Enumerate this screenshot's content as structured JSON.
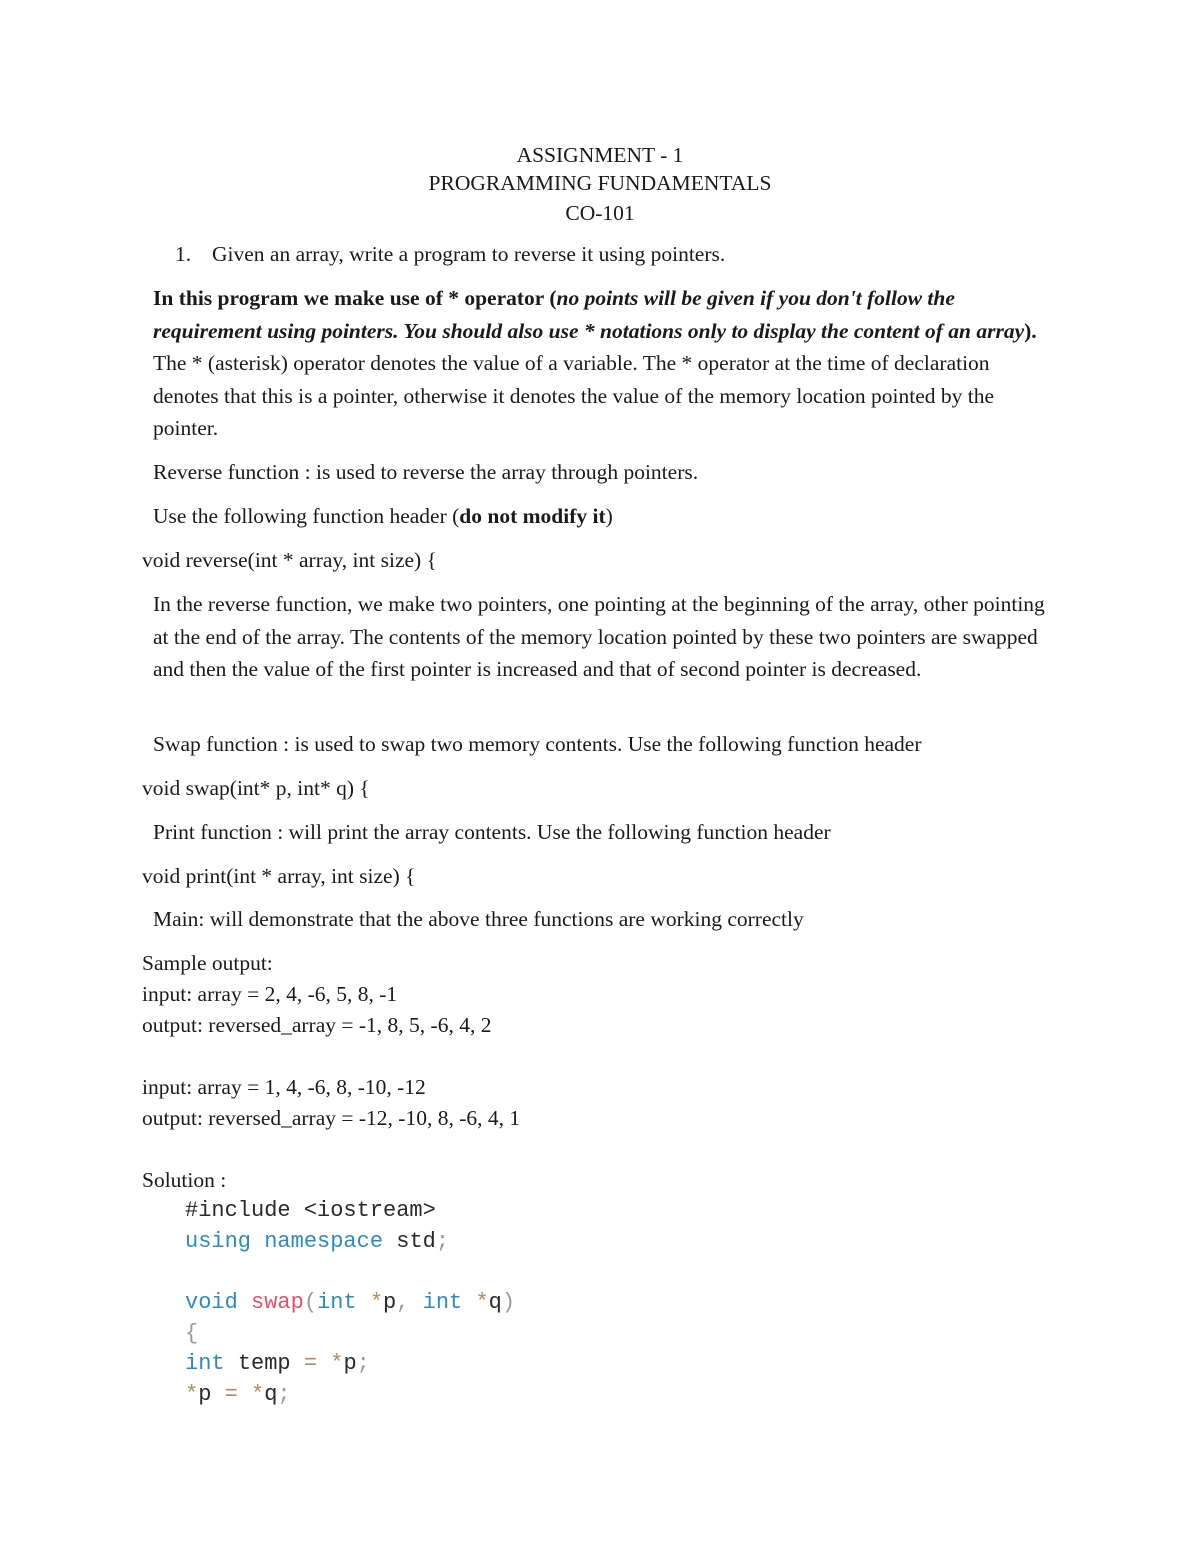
{
  "header": {
    "title": "ASSIGNMENT - 1",
    "subject": "PROGRAMMING FUNDAMENTALS",
    "code": "CO-101"
  },
  "question": {
    "number": "1.",
    "text": "Given an array, write a program to reverse it using pointers."
  },
  "intro": {
    "bold_lead": "In this program we make use of * operator (",
    "bold_italic": "no points will be given if you don't follow the requirement using pointers. You should also use * notations only to display the content of an array",
    "bold_close": ").",
    "rest": " The * (asterisk) operator denotes the value of a variable. The * operator at the time of declaration denotes that this is a pointer, otherwise it denotes the value of the memory location pointed by the pointer."
  },
  "reverse_desc": "Reverse function : is used to reverse the array through pointers.",
  "header_note": {
    "text": "Use the following function header (",
    "bold": "do not modify it",
    "close": ")"
  },
  "reverse_header": "void reverse(int * array, int size) {",
  "reverse_explain": "In the reverse function, we make two pointers, one pointing at the beginning of the array, other pointing at the end of the array. The contents of the memory location pointed by these two pointers are swapped and then the value of the first pointer is increased and that of second pointer is decreased.",
  "swap_desc": "Swap function : is used to swap two memory contents. Use the following function header",
  "swap_header": "void swap(int* p, int* q) {",
  "print_desc": "Print function : will print the array contents. Use the following function header",
  "print_header": "void print(int * array, int size) {",
  "main_desc": "Main: will demonstrate that the above three functions are working correctly",
  "sample": {
    "label": "Sample output:",
    "cases": [
      {
        "input": "input: array = 2, 4, -6, 5, 8, -1",
        "output": "output: reversed_array = -1, 8, 5, -6, 4, 2"
      },
      {
        "input": "input: array = 1, 4, -6, 8, -10, -12",
        "output": "output: reversed_array = -12, -10, 8, -6, 4, 1"
      }
    ]
  },
  "solution": {
    "label": "Solution :",
    "code": {
      "include": "#include <iostream>",
      "using": "using",
      "namespace": "namespace",
      "std": "std",
      "semi": ";",
      "void": "void",
      "swap": "swap",
      "lparen": "(",
      "int": "int",
      "star": "*",
      "p": "p",
      "comma": ",",
      "q": "q",
      "rparen": ")",
      "lbrace": "{",
      "temp": "temp",
      "eq": "="
    }
  }
}
